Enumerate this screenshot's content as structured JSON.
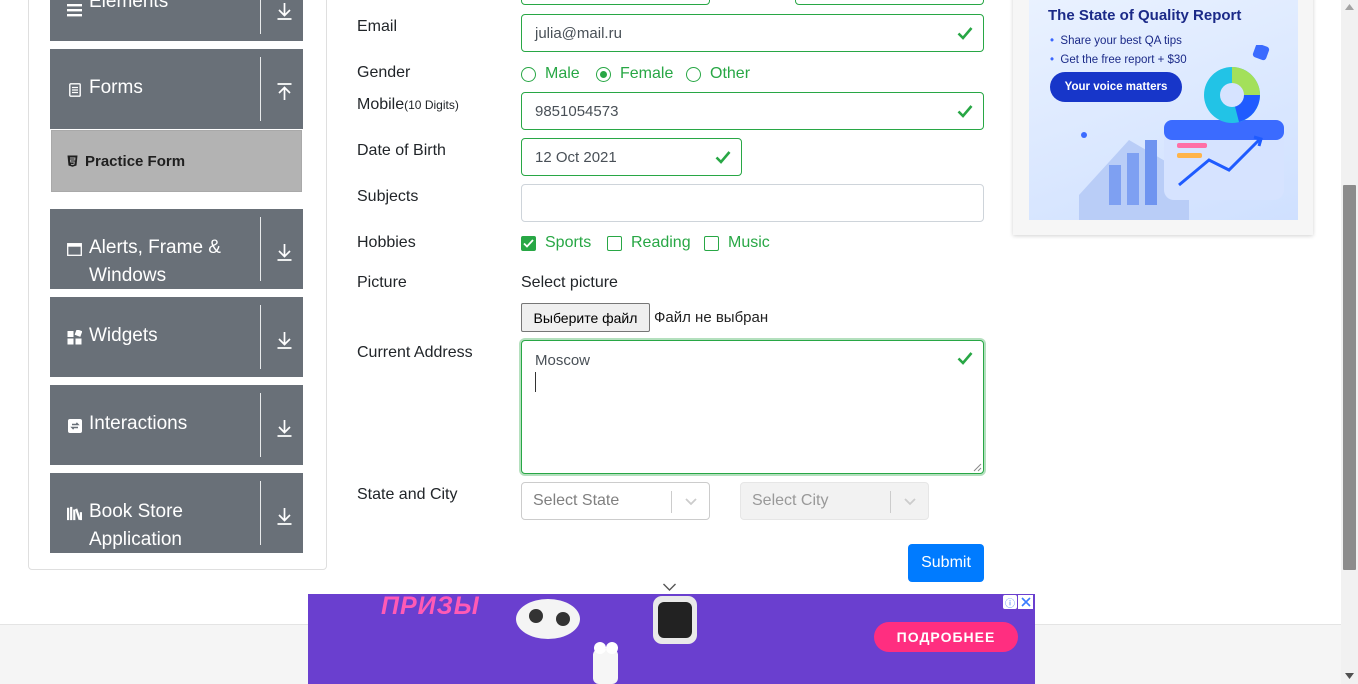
{
  "sidebar": {
    "elements_label": "Elements",
    "forms_label": "Forms",
    "practice_form_label": "Practice Form",
    "alerts_label_line1": "Alerts, Frame &",
    "alerts_label_line2": "Windows",
    "widgets_label": "Widgets",
    "interactions_label": "Interactions",
    "bookstore_label_line1": "Book Store",
    "bookstore_label_line2": "Application"
  },
  "form": {
    "email_label": "Email",
    "email_value": "julia@mail.ru",
    "gender_label": "Gender",
    "gender_options": [
      "Male",
      "Female",
      "Other"
    ],
    "gender_selected": "Female",
    "mobile_label": "Mobile",
    "mobile_hint": "(10 Digits)",
    "mobile_value": "9851054573",
    "dob_label": "Date of Birth",
    "dob_value": "12 Oct 2021",
    "subjects_label": "Subjects",
    "subjects_value": "",
    "hobbies_label": "Hobbies",
    "hobbies": [
      {
        "label": "Sports",
        "checked": true
      },
      {
        "label": "Reading",
        "checked": false
      },
      {
        "label": "Music",
        "checked": false
      }
    ],
    "picture_label": "Picture",
    "picture_caption": "Select picture",
    "file_button": "Выберите файл",
    "file_status": "Файл не выбран",
    "address_label": "Current Address",
    "address_value": "Moscow",
    "state_city_label": "State and City",
    "state_placeholder": "Select State",
    "city_placeholder": "Select City",
    "submit_label": "Submit"
  },
  "ads": {
    "right_title": "The State of Quality Report",
    "right_bullets": [
      "Share your best QA tips",
      "Get the free report + $30"
    ],
    "right_cta": "Your voice matters",
    "bottom_headline": "ПРИЗЫ",
    "bottom_cta": "ПОДРОБНЕЕ"
  },
  "colors": {
    "valid_green": "#28a745",
    "sidebar_gray": "#697078",
    "primary_blue": "#007bff"
  }
}
